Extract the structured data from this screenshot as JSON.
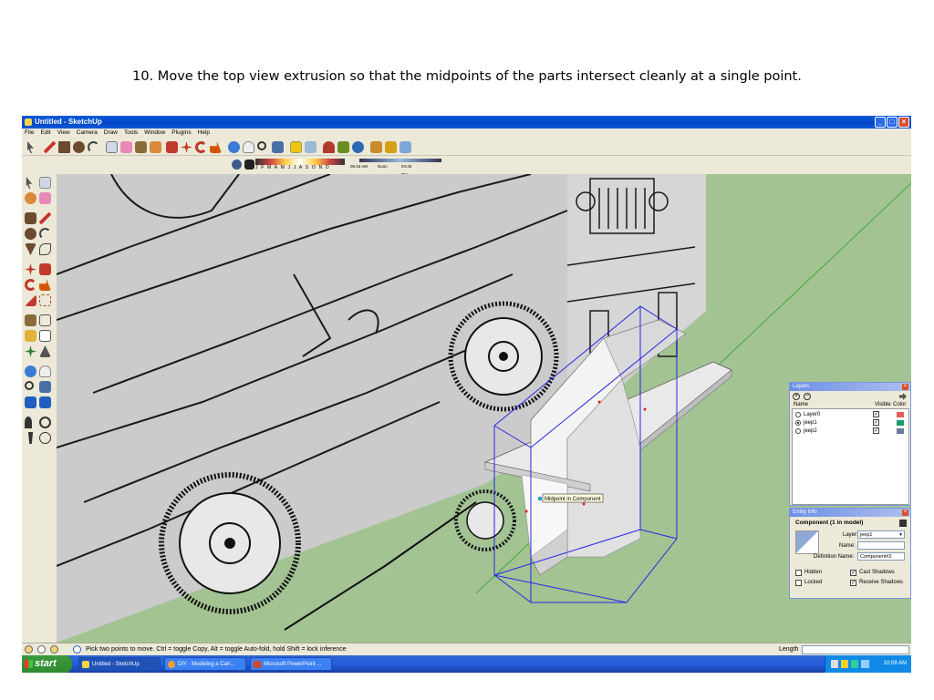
{
  "caption": "10. Move the top view extrusion so that the midpoints of the parts intersect cleanly at a single point.",
  "window": {
    "title": "Untitled - SketchUp",
    "controls": [
      "_",
      "□",
      "×"
    ]
  },
  "menu": [
    "File",
    "Edit",
    "View",
    "Camera",
    "Draw",
    "Tools",
    "Window",
    "Plugins",
    "Help"
  ],
  "shadows": {
    "months": "J F M A M J J A S O N D",
    "time_start": "06:43 AM",
    "time_mid": "Noon",
    "time_end": "04:46 PM"
  },
  "tooltip": "Midpoint in Component",
  "status": {
    "hint": "Pick two points to move.  Ctrl = toggle Copy, Alt = toggle Auto-fold, hold Shift = lock inference",
    "length_label": "Length",
    "length_value": ""
  },
  "layers_panel": {
    "title": "Layers",
    "columns": [
      "Name",
      "Visible",
      "Color"
    ],
    "rows": [
      {
        "name": "Layer0",
        "active": false,
        "visible": true,
        "color": "#e85b5b"
      },
      {
        "name": "jeep1",
        "active": true,
        "visible": true,
        "color": "#1e9b6e"
      },
      {
        "name": "jeep2",
        "active": false,
        "visible": true,
        "color": "#6d7a9a"
      }
    ]
  },
  "entity_panel": {
    "title": "Entity Info",
    "heading": "Component (1 in model)",
    "layer_label": "Layer:",
    "layer_value": "jeep1",
    "name_label": "Name:",
    "name_value": "",
    "defname_label": "Definition Name:",
    "defname_value": "Component#2",
    "hidden_label": "Hidden",
    "locked_label": "Locked",
    "cast_label": "Cast Shadows",
    "receive_label": "Receive Shadows"
  },
  "taskbar": {
    "start": "start",
    "tasks": [
      "Untitled - SketchUp",
      "DIY - Modeling a Car/...",
      "Microsoft PowerPoint ..."
    ],
    "clock": "10:08 AM"
  },
  "colors": {
    "sketchup_ground": "#a3c393",
    "xp_blue": "#245edb",
    "selection_blue": "#2626e6"
  }
}
